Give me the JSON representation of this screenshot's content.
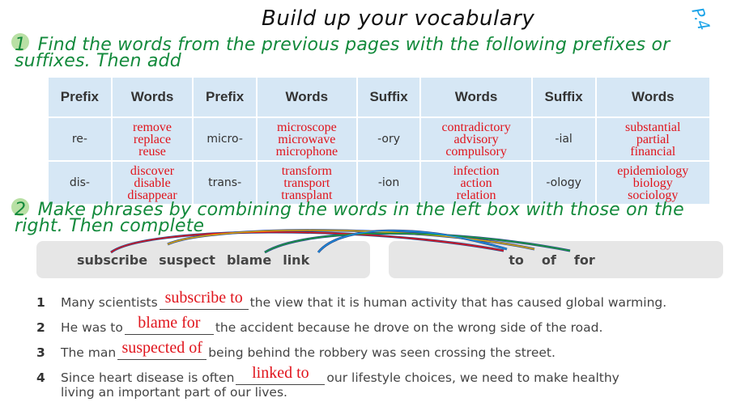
{
  "title": "Build up your vocabulary",
  "page_marker": "P.4",
  "section1": {
    "number": "1",
    "instruction": "Find the words from the previous pages with the following prefixes or suffixes. Then add",
    "table": {
      "headers": [
        "Prefix",
        "Words",
        "Prefix",
        "Words",
        "Suffix",
        "Words",
        "Suffix",
        "Words"
      ],
      "rows": [
        {
          "cells": [
            {
              "affix": "re-"
            },
            {
              "words": [
                "remove",
                "replace",
                "reuse"
              ]
            },
            {
              "affix": "micro-"
            },
            {
              "words": [
                "microscope",
                "microwave",
                "microphone"
              ]
            },
            {
              "affix": "-ory"
            },
            {
              "words": [
                "contradictory",
                "advisory",
                "compulsory"
              ]
            },
            {
              "affix": "-ial"
            },
            {
              "words": [
                "substantial",
                "partial",
                "financial"
              ]
            }
          ]
        },
        {
          "cells": [
            {
              "affix": "dis-"
            },
            {
              "words": [
                "discover",
                "disable",
                "disappear"
              ]
            },
            {
              "affix": "trans-"
            },
            {
              "words": [
                "transform",
                "transport",
                "transplant"
              ]
            },
            {
              "affix": "-ion"
            },
            {
              "words": [
                "infection",
                "action",
                "relation"
              ]
            },
            {
              "affix": "-ology"
            },
            {
              "words": [
                "epidemiology",
                "biology",
                "sociology"
              ]
            }
          ]
        }
      ]
    }
  },
  "section2": {
    "number": "2",
    "instruction": "Make phrases by combining the words in the left box with those on the right. Then complete",
    "left_box": [
      "subscribe",
      "suspect",
      "blame",
      "link"
    ],
    "right_box": [
      "to",
      "of",
      "for"
    ],
    "connector_colors": {
      "subscribe": "#e0141c",
      "suspect": "#e0a80c",
      "blame": "#1a9a3c",
      "link": "#1a8ee0",
      "line": "#2a4a8a"
    },
    "sentences": [
      {
        "n": "1",
        "before": "Many scientists",
        "answer": "subscribe to",
        "after": "the view that it is human activity that has caused global warming."
      },
      {
        "n": "2",
        "before": "He was to",
        "answer": "blame for",
        "after": "the accident because he drove on the wrong side of the road."
      },
      {
        "n": "3",
        "before": "The man",
        "answer": "suspected of",
        "after": "being behind the robbery was seen crossing the street."
      },
      {
        "n": "4",
        "before": "Since heart disease is often",
        "answer": "linked to",
        "after": "our lifestyle choices, we need to make healthy",
        "continuation": "living an important part of our lives."
      }
    ]
  }
}
